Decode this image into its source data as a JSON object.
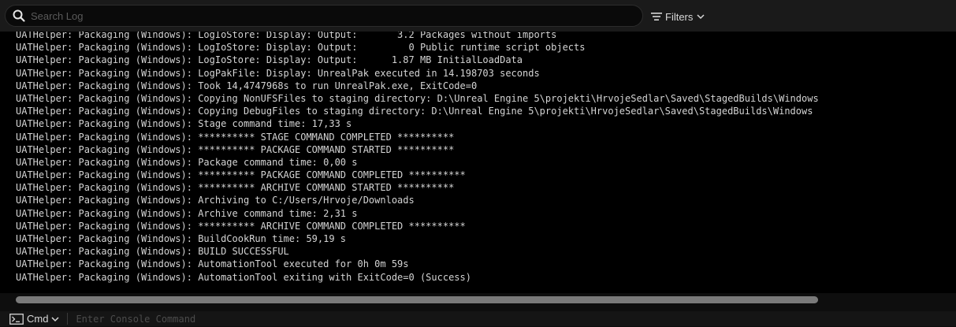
{
  "search": {
    "placeholder": "Search Log"
  },
  "filters": {
    "label": "Filters"
  },
  "log": {
    "lines": [
      "UATHelper: Packaging (Windows): LogIoStore: Display: Output:       3.2 Packages without imports",
      "UATHelper: Packaging (Windows): LogIoStore: Display: Output:         0 Public runtime script objects",
      "UATHelper: Packaging (Windows): LogIoStore: Display: Output:      1.87 MB InitialLoadData",
      "UATHelper: Packaging (Windows): LogPakFile: Display: UnrealPak executed in 14.198703 seconds",
      "UATHelper: Packaging (Windows): Took 14,4747968s to run UnrealPak.exe, ExitCode=0",
      "UATHelper: Packaging (Windows): Copying NonUFSFiles to staging directory: D:\\Unreal Engine 5\\projekti\\HrvojeSedlar\\Saved\\StagedBuilds\\Windows",
      "UATHelper: Packaging (Windows): Copying DebugFiles to staging directory: D:\\Unreal Engine 5\\projekti\\HrvojeSedlar\\Saved\\StagedBuilds\\Windows",
      "UATHelper: Packaging (Windows): Stage command time: 17,33 s",
      "UATHelper: Packaging (Windows): ********** STAGE COMMAND COMPLETED **********",
      "UATHelper: Packaging (Windows): ********** PACKAGE COMMAND STARTED **********",
      "UATHelper: Packaging (Windows): Package command time: 0,00 s",
      "UATHelper: Packaging (Windows): ********** PACKAGE COMMAND COMPLETED **********",
      "UATHelper: Packaging (Windows): ********** ARCHIVE COMMAND STARTED **********",
      "UATHelper: Packaging (Windows): Archiving to C:/Users/Hrvoje/Downloads",
      "UATHelper: Packaging (Windows): Archive command time: 2,31 s",
      "UATHelper: Packaging (Windows): ********** ARCHIVE COMMAND COMPLETED **********",
      "UATHelper: Packaging (Windows): BuildCookRun time: 59,19 s",
      "UATHelper: Packaging (Windows): BUILD SUCCESSFUL",
      "UATHelper: Packaging (Windows): AutomationTool executed for 0h 0m 59s",
      "UATHelper: Packaging (Windows): AutomationTool exiting with ExitCode=0 (Success)"
    ]
  },
  "console": {
    "cmd_label": "Cmd",
    "placeholder": "Enter Console Command"
  },
  "icons": {
    "search": "search-icon",
    "filters": "filter-lines-icon",
    "dropdown": "chevron-down-icon",
    "terminal": "terminal-icon"
  },
  "colors": {
    "background": "#000000",
    "toolbar": "#1a1a1a",
    "text": "#d4d4d4",
    "scrollbar": "#7a7a7a"
  }
}
